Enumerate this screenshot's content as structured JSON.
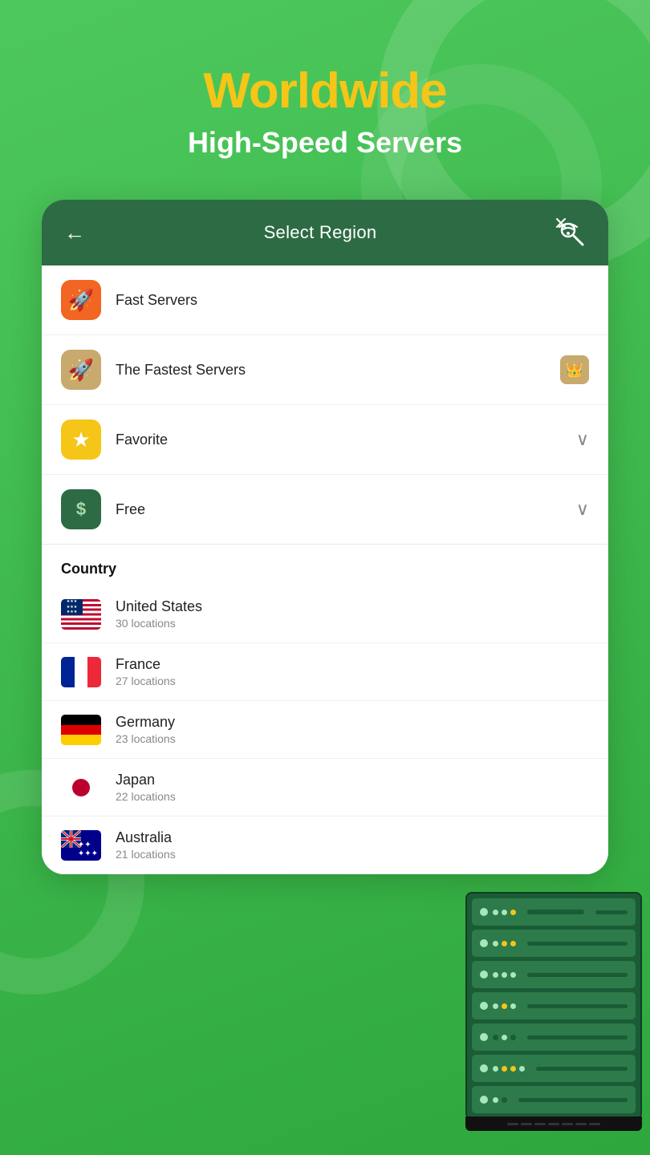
{
  "hero": {
    "title": "Worldwide",
    "subtitle": "High-Speed Servers"
  },
  "header": {
    "back_label": "←",
    "title": "Select Region"
  },
  "menu_items": [
    {
      "id": "fast",
      "label": "Fast Servers",
      "icon_type": "rocket",
      "icon_bg": "orange",
      "right": null
    },
    {
      "id": "fastest",
      "label": "The Fastest Servers",
      "icon_type": "rocket_tan",
      "icon_bg": "tan",
      "right": "crown"
    },
    {
      "id": "favorite",
      "label": "Favorite",
      "icon_type": "star",
      "icon_bg": "yellow",
      "right": "chevron"
    },
    {
      "id": "free",
      "label": "Free",
      "icon_type": "dollar",
      "icon_bg": "green_dark",
      "right": "chevron"
    }
  ],
  "country_section": {
    "header": "Country",
    "countries": [
      {
        "name": "United States",
        "locations": "30 locations",
        "flag": "us"
      },
      {
        "name": "France",
        "locations": "27 locations",
        "flag": "fr"
      },
      {
        "name": "Germany",
        "locations": "23 locations",
        "flag": "de"
      },
      {
        "name": "Japan",
        "locations": "22 locations",
        "flag": "jp"
      },
      {
        "name": "Australia",
        "locations": "21 locations",
        "flag": "au"
      }
    ]
  }
}
